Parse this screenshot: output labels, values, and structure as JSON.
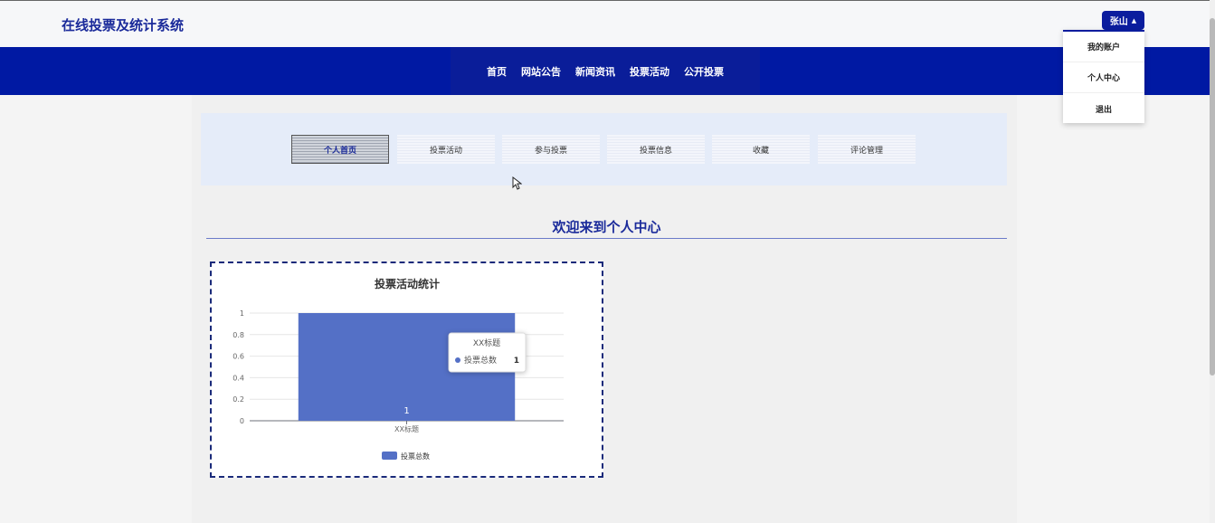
{
  "header": {
    "title": "在线投票及统计系统"
  },
  "user_menu": {
    "user_name": "张山",
    "items": [
      "我的账户",
      "个人中心",
      "退出"
    ]
  },
  "nav": {
    "items": [
      "首页",
      "网站公告",
      "新闻资讯",
      "投票活动",
      "公开投票"
    ]
  },
  "tabs": [
    "个人首页",
    "投票活动",
    "参与投票",
    "投票信息",
    "收藏",
    "评论管理"
  ],
  "active_tab": "个人首页",
  "welcome_text": "欢迎来到个人中心",
  "chart_data": {
    "type": "bar",
    "title": "投票活动统计",
    "categories": [
      "XX标题"
    ],
    "series": [
      {
        "name": "投票总数",
        "values": [
          1
        ],
        "color": "#5470c6"
      }
    ],
    "ylim": [
      0,
      1
    ],
    "yticks": [
      0,
      0.2,
      0.4,
      0.6,
      0.8,
      1
    ],
    "grid": true,
    "legend": "bottom-center",
    "data_label": "1",
    "tooltip": {
      "title": "XX标题",
      "series": "投票总数",
      "value": "1"
    }
  }
}
